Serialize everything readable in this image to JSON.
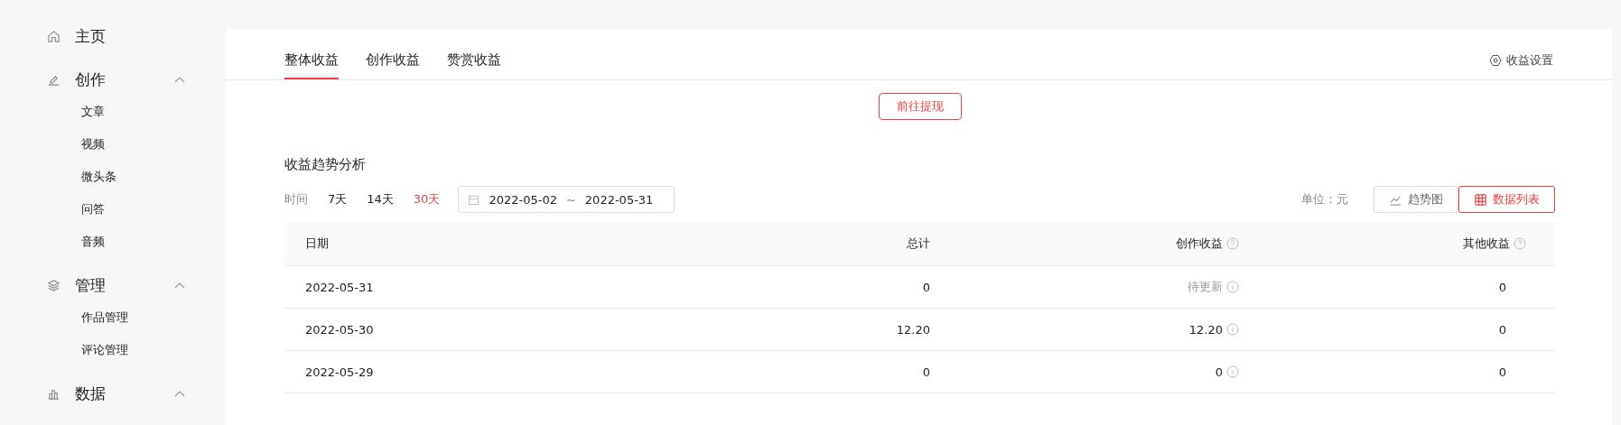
{
  "sidebar": {
    "items": [
      {
        "label": "主页"
      },
      {
        "label": "创作",
        "expanded": true,
        "children": [
          {
            "label": "文章"
          },
          {
            "label": "视频"
          },
          {
            "label": "微头条"
          },
          {
            "label": "问答"
          },
          {
            "label": "音频"
          }
        ]
      },
      {
        "label": "管理",
        "expanded": true,
        "children": [
          {
            "label": "作品管理"
          },
          {
            "label": "评论管理"
          }
        ]
      },
      {
        "label": "数据",
        "expanded": true
      }
    ]
  },
  "tabs": [
    {
      "label": "整体收益",
      "selected": true
    },
    {
      "label": "创作收益",
      "selected": false
    },
    {
      "label": "赞赏收益",
      "selected": false
    }
  ],
  "settings_link": "收益设置",
  "withdraw_button": "前往提现",
  "section_title": "收益趋势分析",
  "time_filter": {
    "label": "时间",
    "options": [
      {
        "label": "7天",
        "selected": false
      },
      {
        "label": "14天",
        "selected": false
      },
      {
        "label": "30天",
        "selected": true
      }
    ]
  },
  "date_range": {
    "start": "2022-05-02",
    "separator": "~",
    "end": "2022-05-31"
  },
  "unit": "单位：元",
  "view_toggle": [
    {
      "label": "趋势图",
      "selected": false
    },
    {
      "label": "数据列表",
      "selected": true
    }
  ],
  "table": {
    "columns": [
      {
        "label": "日期",
        "help": false
      },
      {
        "label": "总计",
        "help": false
      },
      {
        "label": "创作收益",
        "help": true
      },
      {
        "label": "其他收益",
        "help": true
      }
    ],
    "rows": [
      {
        "date": "2022-05-31",
        "total": "0",
        "creation": "待更新",
        "pending": true,
        "other": "0"
      },
      {
        "date": "2022-05-30",
        "total": "12.20",
        "creation": "12.20",
        "pending": false,
        "other": "0"
      },
      {
        "date": "2022-05-29",
        "total": "0",
        "creation": "0",
        "pending": false,
        "other": "0"
      }
    ]
  }
}
